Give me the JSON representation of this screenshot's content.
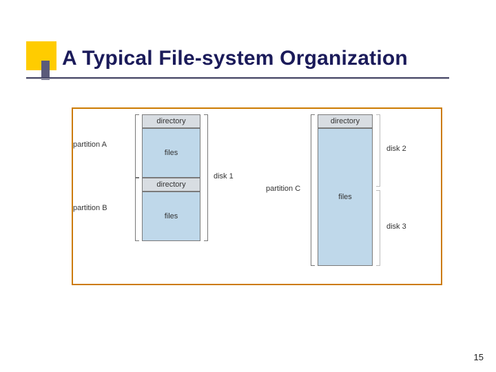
{
  "title": "A Typical File-system Organization",
  "page_number": "15",
  "diagram": {
    "left_col": {
      "a": {
        "dir": "directory",
        "files": "files"
      },
      "b": {
        "dir": "directory",
        "files": "files"
      }
    },
    "right_col": {
      "dir": "directory",
      "files": "files"
    },
    "labels": {
      "partition_a": "partition A",
      "partition_b": "partition B",
      "partition_c": "partition C",
      "disk1": "disk 1",
      "disk2": "disk 2",
      "disk3": "disk 3"
    }
  }
}
